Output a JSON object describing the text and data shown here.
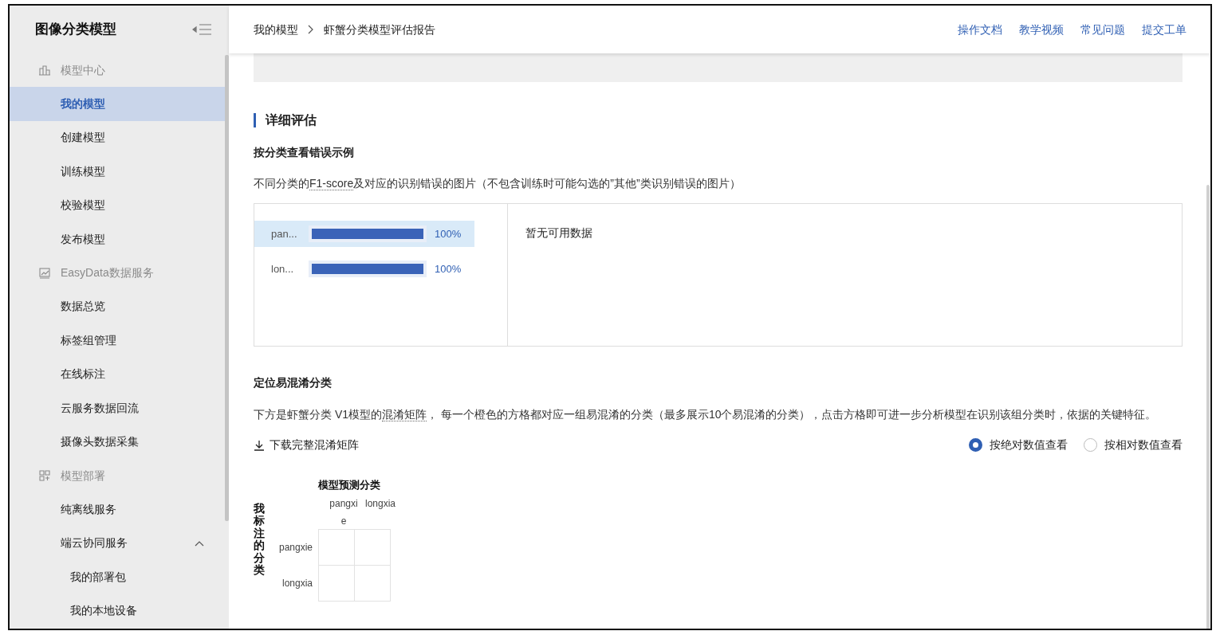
{
  "sidebar": {
    "title": "图像分类模型",
    "groups": [
      {
        "label": "模型中心",
        "kind": "building",
        "items": [
          {
            "label": "我的模型",
            "selected": true
          },
          {
            "label": "创建模型",
            "selected": false
          },
          {
            "label": "训练模型",
            "selected": false
          },
          {
            "label": "校验模型",
            "selected": false
          },
          {
            "label": "发布模型",
            "selected": false
          }
        ]
      },
      {
        "label": "EasyData数据服务",
        "kind": "chart",
        "items": [
          {
            "label": "数据总览",
            "selected": false
          },
          {
            "label": "标签组管理",
            "selected": false
          },
          {
            "label": "在线标注",
            "selected": false
          },
          {
            "label": "云服务数据回流",
            "selected": false
          },
          {
            "label": "摄像头数据采集",
            "selected": false
          }
        ]
      },
      {
        "label": "模型部署",
        "kind": "deploy",
        "items": [
          {
            "label": "纯离线服务",
            "selected": false
          },
          {
            "label": "端云协同服务",
            "selected": false,
            "expanded": true,
            "children": [
              {
                "label": "我的部署包",
                "selected": false
              },
              {
                "label": "我的本地设备",
                "selected": false
              }
            ]
          }
        ]
      }
    ]
  },
  "breadcrumb": [
    "我的模型",
    "虾蟹分类模型评估报告"
  ],
  "header_links": [
    "操作文档",
    "教学视频",
    "常见问题",
    "提交工单"
  ],
  "section_title": "详细评估",
  "error_examples": {
    "heading": "按分类查看错误示例",
    "description": [
      {
        "kind": "plain",
        "text": "不同分类的"
      },
      {
        "kind": "term",
        "text": "F1-score"
      },
      {
        "kind": "plain",
        "text": "及对应的识别错误的图片（不包含训练时可能勾选的”其他”类识别错误的图片）"
      }
    ],
    "classes": [
      {
        "label": "pan...",
        "level": 1,
        "value": "100%",
        "selected": true
      },
      {
        "label": "lon...",
        "level": 1,
        "value": "100%",
        "selected": false
      }
    ],
    "empty_text": "暂无可用数据"
  },
  "confusion": {
    "heading": "定位易混淆分类",
    "description": [
      {
        "kind": "plain",
        "text": "下方是虾蟹分类 V1模型的"
      },
      {
        "kind": "term",
        "text": "混淆矩阵"
      },
      {
        "kind": "plain",
        "text": "， 每一个橙色的方格都对应一组易混淆的分类（最多展示10个易混淆的分类），点击方格即可进一步分析模型在识别该组分类时，依据的关键特征。"
      }
    ],
    "download": "下载完整混淆矩阵",
    "view_options": [
      {
        "label": "按绝对数值查看",
        "selected": true
      },
      {
        "label": "按相对数值查看",
        "selected": false
      }
    ],
    "matrix": {
      "column_title": "模型预测分类",
      "row_title": "我标注的分类",
      "columns": [
        "pangxie",
        "longxia"
      ],
      "rows": [
        "pangxie",
        "longxia"
      ]
    }
  }
}
